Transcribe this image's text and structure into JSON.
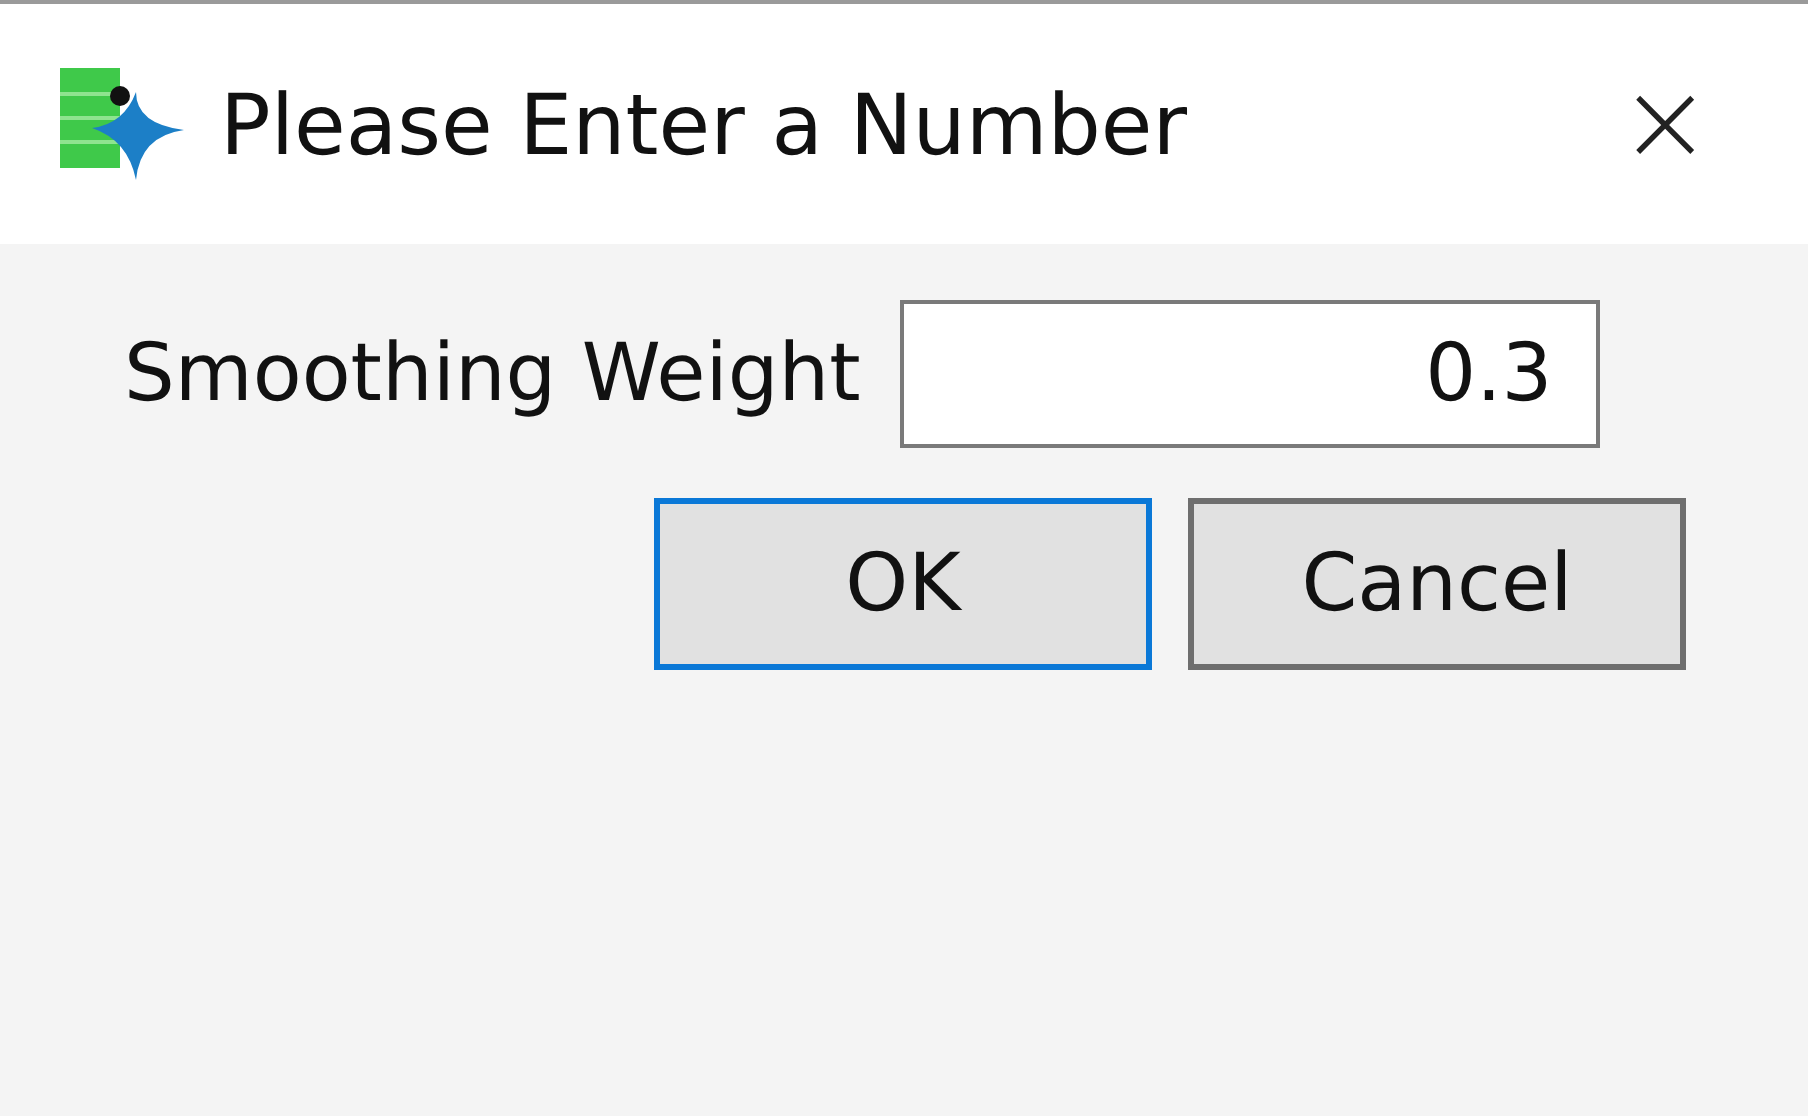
{
  "window": {
    "title": "Please Enter a Number",
    "close": "×"
  },
  "field": {
    "label": "Smoothing Weight",
    "value": "0.3"
  },
  "buttons": [
    {
      "label": "OK",
      "focused": true
    },
    {
      "label": "Cancel",
      "focused": false
    }
  ]
}
